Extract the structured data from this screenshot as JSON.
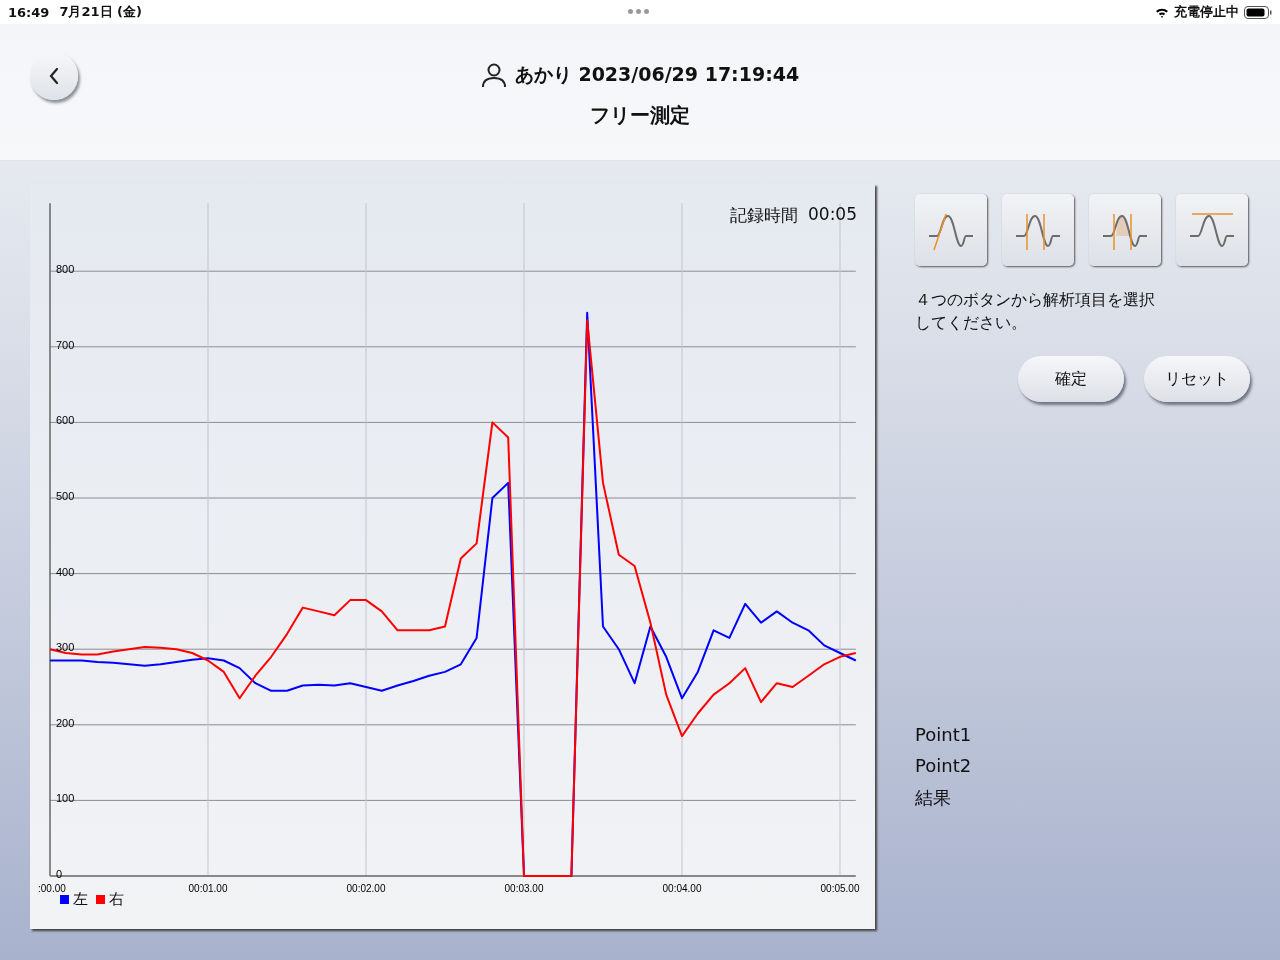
{
  "status_bar": {
    "time": "16:49",
    "date": "7月21日 (金)",
    "charging": "充電停止中"
  },
  "header": {
    "user": "あかり 2023/06/29 17:19:44",
    "title": "フリー測定"
  },
  "chart_panel": {
    "record_label": "記録時間",
    "record_time": "00:05",
    "chart_data": {
      "type": "line",
      "categories": [
        ":00.00",
        null,
        null,
        null,
        null,
        null,
        null,
        null,
        null,
        null,
        "00:01.00",
        null,
        null,
        null,
        null,
        null,
        null,
        null,
        null,
        null,
        "00:02.00",
        null,
        null,
        null,
        null,
        null,
        null,
        null,
        null,
        null,
        "00:03.00",
        null,
        null,
        null,
        null,
        null,
        null,
        null,
        null,
        null,
        "00:04.00",
        null,
        null,
        null,
        null,
        null,
        null,
        null,
        null,
        null,
        "00:05.00",
        null
      ],
      "series": [
        {
          "name": "左",
          "color": "#0000ff",
          "values": [
            285,
            285,
            285,
            283,
            282,
            280,
            278,
            280,
            283,
            286,
            288,
            285,
            275,
            255,
            245,
            245,
            252,
            253,
            252,
            255,
            250,
            245,
            252,
            258,
            265,
            270,
            280,
            315,
            500,
            520,
            0,
            0,
            0,
            0,
            745,
            330,
            300,
            255,
            330,
            290,
            235,
            270,
            325,
            315,
            360,
            335,
            350,
            335,
            325,
            305,
            295,
            285
          ]
        },
        {
          "name": "右",
          "color": "#ff0000",
          "values": [
            300,
            295,
            293,
            293,
            297,
            300,
            303,
            302,
            300,
            295,
            285,
            270,
            235,
            265,
            290,
            320,
            355,
            350,
            345,
            365,
            365,
            350,
            325,
            325,
            325,
            330,
            420,
            440,
            600,
            580,
            0,
            0,
            0,
            0,
            735,
            520,
            425,
            410,
            335,
            240,
            185,
            215,
            240,
            255,
            275,
            230,
            255,
            250,
            265,
            280,
            290,
            295
          ]
        }
      ],
      "ylim": [
        0,
        890
      ],
      "grid": true,
      "yticks": [
        0,
        100,
        200,
        300,
        400,
        500,
        600,
        700,
        800
      ]
    }
  },
  "analysis_buttons": [
    {
      "kind": "slope"
    },
    {
      "kind": "width"
    },
    {
      "kind": "area"
    },
    {
      "kind": "peak"
    }
  ],
  "instruction": "４つのボタンから解析項目を選択してください。",
  "buttons": [
    "確定",
    "リセット"
  ],
  "results": [
    "Point1",
    "Point2",
    "結果"
  ]
}
